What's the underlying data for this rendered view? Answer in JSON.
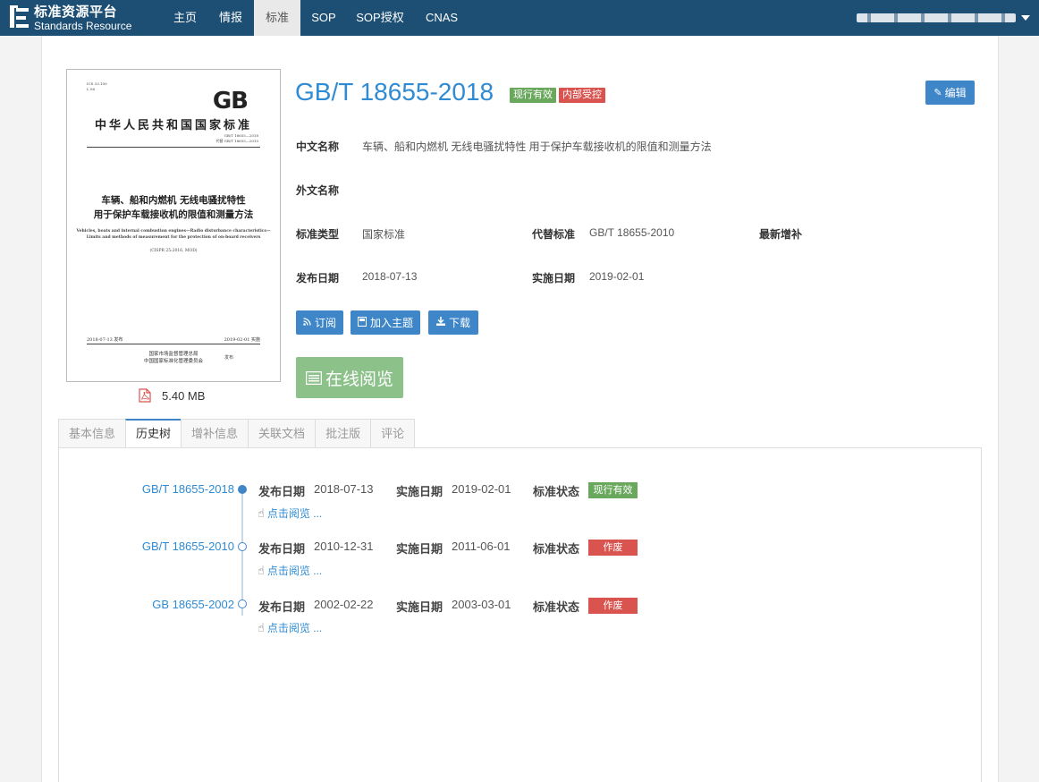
{
  "brand": {
    "name_cn": "标准资源平台",
    "name_en": "Standards Resource"
  },
  "nav": [
    {
      "label": "主页"
    },
    {
      "label": "情报"
    },
    {
      "label": "标准"
    },
    {
      "label": "SOP"
    },
    {
      "label": "SOP授权"
    },
    {
      "label": "CNAS"
    }
  ],
  "active_nav": "标准",
  "cover": {
    "ics": "ICS 33.100",
    "ccs": "L 06",
    "gb_mark": "GB",
    "country": "中华人民共和国国家标准",
    "code_line1": "GB/T 18655—2018",
    "code_line2": "代替 GB/T 18655—2010",
    "title_line1": "车辆、船和内燃机   无线电骚扰特性",
    "title_line2": "用于保护车载接收机的限值和测量方法",
    "en_line1": "Vehicles, boats and internal combustion engines—Radio disturbance characteristics—",
    "en_line2": "Limits and methods of measurement for the protection of on-board receivers",
    "sub": "(CISPR 25:2016, MOD)",
    "date_left": "2018-07-13 发布",
    "date_right": "2019-02-01 实施",
    "issuer1": "国家市场监督管理总局",
    "issuer2": "中国国家标准化管理委员会",
    "issue_word": "发布"
  },
  "file_size": "5.40 MB",
  "standard": {
    "number": "GB/T 18655-2018",
    "badges": [
      "现行有效",
      "内部受控"
    ],
    "edit_label": "编辑",
    "fields": {
      "cn_name_label": "中文名称",
      "cn_name": "车辆、船和内燃机 无线电骚扰特性 用于保护车载接收机的限值和测量方法",
      "foreign_name_label": "外文名称",
      "foreign_name": "",
      "type_label": "标准类型",
      "type": "国家标准",
      "replace_label": "代替标准",
      "replace": "GB/T 18655-2010",
      "latest_supp_label": "最新增补",
      "latest_supp": "",
      "publish_label": "发布日期",
      "publish": "2018-07-13",
      "impl_label": "实施日期",
      "impl": "2019-02-01"
    },
    "actions": {
      "subscribe": "订阅",
      "add_topic": "加入主题",
      "download": "下载",
      "read_online": "在线阅览"
    }
  },
  "tabs": [
    "基本信息",
    "历史树",
    "增补信息",
    "关联文档",
    "批注版",
    "评论"
  ],
  "active_tab": "历史树",
  "history_labels": {
    "publish": "发布日期",
    "impl": "实施日期",
    "status": "标准状态",
    "read": "点击阅览 ..."
  },
  "history": [
    {
      "number": "GB/T 18655-2018",
      "publish": "2018-07-13",
      "impl": "2019-02-01",
      "status": "现行有效",
      "status_color": "#6aa85e"
    },
    {
      "number": "GB/T 18655-2010",
      "publish": "2010-12-31",
      "impl": "2011-06-01",
      "status": "作废",
      "status_color": "#d9534f"
    },
    {
      "number": "GB 18655-2002",
      "publish": "2002-02-22",
      "impl": "2003-03-01",
      "status": "作废",
      "status_color": "#d9534f"
    }
  ],
  "colors": {
    "navbar": "#1d4e74",
    "accent": "#3e86c8",
    "link": "#2f8bd3",
    "valid": "#6aa85e",
    "void": "#d9534f",
    "read_button": "#8dc18a"
  }
}
